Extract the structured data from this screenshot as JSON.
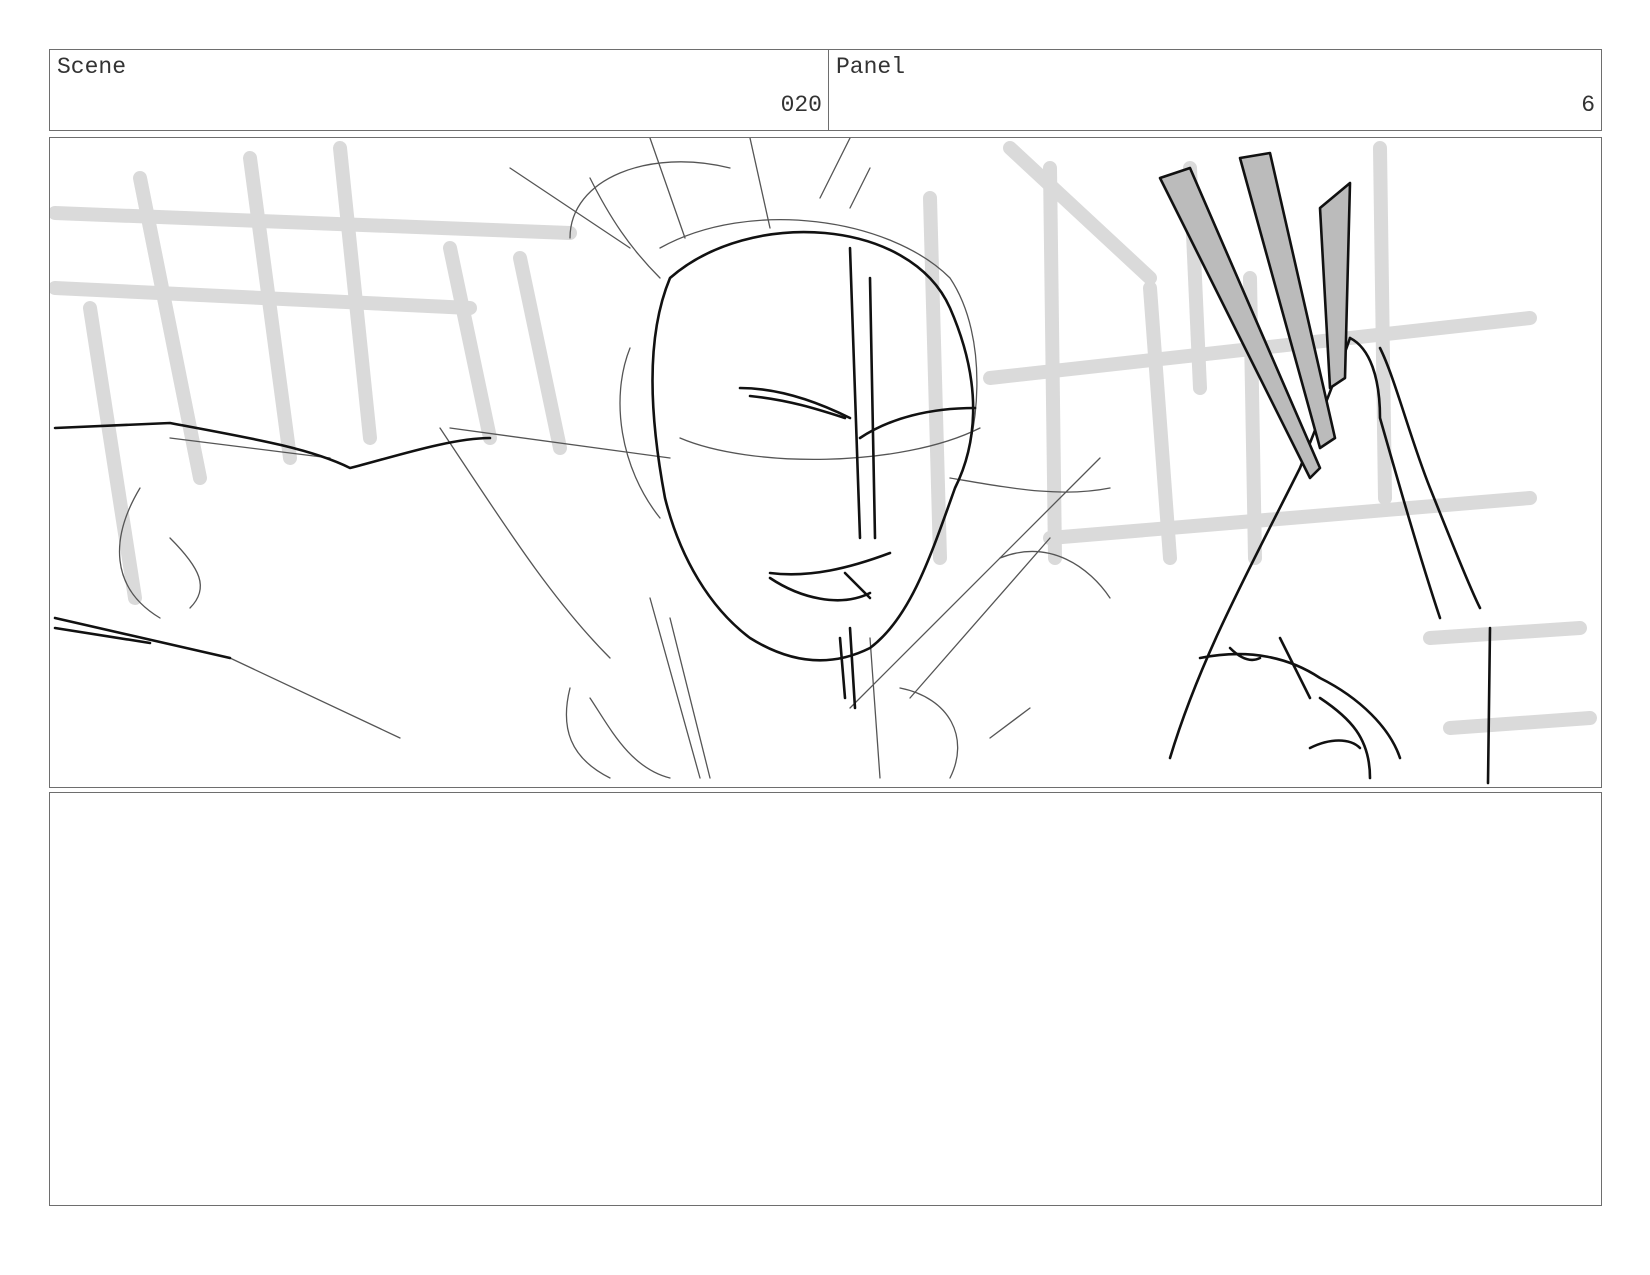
{
  "header": {
    "scene_label": "Scene",
    "scene_value": "020",
    "panel_label": "Panel",
    "panel_value": "6"
  },
  "frame": {
    "description_icon": "sketch-drawing",
    "ink_color": "#111111",
    "tone_color": "#bbbbbb"
  },
  "notes": {
    "text": ""
  }
}
